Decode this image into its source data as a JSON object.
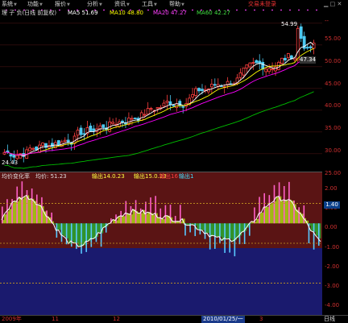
{
  "menubar": {
    "items": [
      {
        "label": "系统"
      },
      {
        "label": "功能"
      },
      {
        "label": "报价"
      },
      {
        "label": "分析"
      },
      {
        "label": "资讯"
      },
      {
        "label": "工具"
      },
      {
        "label": "帮助"
      }
    ],
    "trade_login": "交易未登录"
  },
  "main_header": {
    "title": "理 子 负(日线 前复权)",
    "ma5": "MA5 51.69",
    "ma10": "MA10 48.80",
    "ma20": "MA20 47.27",
    "ma60": "MA60 42.27"
  },
  "main_annotations": {
    "high_price": "54.99",
    "last_price": "47.34",
    "low_price": "24.43"
  },
  "indicator_header": {
    "name": "均价变化率",
    "avg": "均价: 51.23",
    "out1": "输出14.0.23",
    "out2": "输出15.0.23",
    "out3": "输出16",
    "out4": "输出1"
  },
  "right_axis": {
    "main_ticks": [
      "55.00",
      "50.00",
      "45.00",
      "40.00",
      "35.00",
      "30.00",
      "25.00"
    ],
    "ind_ticks": [
      "2.00",
      "1.00",
      "1.40",
      "0.00",
      "-1.00",
      "-2.00",
      "-3.00",
      "-4.00"
    ],
    "dash": "--"
  },
  "ind_badge": "1.40",
  "bottom_dates": [
    "2009年",
    "11",
    "12",
    "2010/01/25/一",
    "3"
  ],
  "corner_label": "日线",
  "colors": {
    "up_candle": "#ff4040",
    "down_candle": "#4cc9f0",
    "ma5": "#ffffff",
    "ma10": "#ffff00",
    "ma20": "#ff00ff",
    "ma60": "#00c000",
    "ind_upper_bg": "#5a1414",
    "ind_lower_bg": "#1a1a6e",
    "ind_line": "#ffffff",
    "ind_fill_pos": "#a7c912",
    "ind_fill_neg": "#2e9e2e"
  },
  "chart_data": {
    "type": "candlestick",
    "price_axis_ticks": [
      25,
      30,
      35,
      40,
      45,
      50,
      55
    ],
    "price_range": [
      22,
      57
    ],
    "highest": 54.99,
    "lowest": 24.43,
    "indicator_axis_ticks": [
      2,
      1,
      0,
      -1,
      -2,
      -3,
      -4
    ],
    "indicator_range": [
      -4.6,
      2.6
    ]
  }
}
